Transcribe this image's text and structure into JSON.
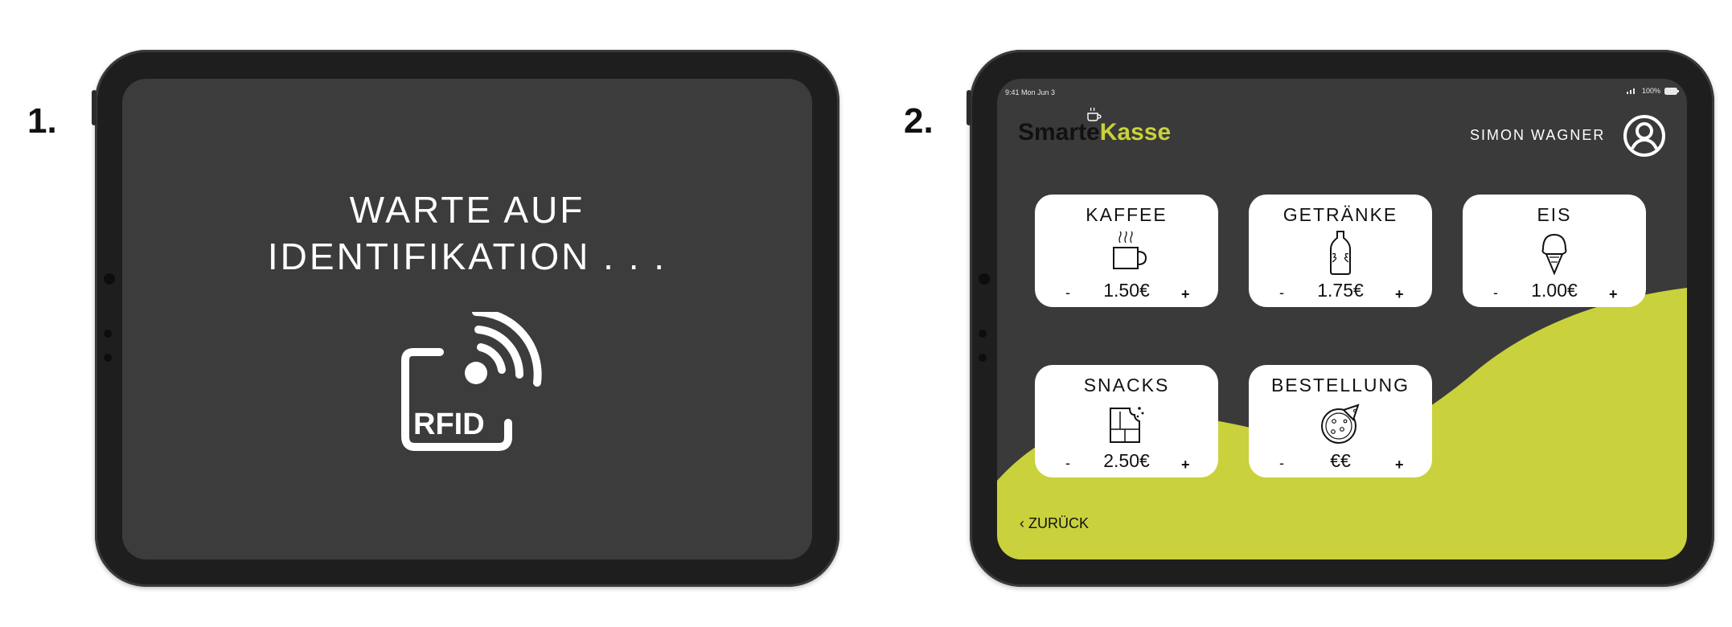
{
  "steps": [
    "1.",
    "2."
  ],
  "screen1": {
    "line1": "WARTE AUF",
    "line2": "IDENTIFIKATION . . .",
    "rfid_label": "RFID"
  },
  "screen2": {
    "status": {
      "time": "9:41 Mon Jun 3",
      "battery": "100%"
    },
    "logo": {
      "part1": "Smarte",
      "part2": "Kasse"
    },
    "user_name": "SIMON WAGNER",
    "products": [
      {
        "title": "KAFFEE",
        "price": "1.50€",
        "icon": "coffee-cup-icon"
      },
      {
        "title": "GETRÄNKE",
        "price": "1.75€",
        "icon": "bottle-icon"
      },
      {
        "title": "EIS",
        "price": "1.00€",
        "icon": "ice-cream-icon"
      },
      {
        "title": "SNACKS",
        "price": "2.50€",
        "icon": "chocolate-bar-icon"
      },
      {
        "title": "BESTELLUNG",
        "price": "€€",
        "icon": "pizza-icon"
      }
    ],
    "minus": "-",
    "plus": "+",
    "back_label": "‹ ZURÜCK"
  },
  "colors": {
    "accent": "#c9d13c",
    "screen_bg": "#3a3a3a",
    "card_bg": "#ffffff",
    "bezel": "#1e1e1e"
  }
}
